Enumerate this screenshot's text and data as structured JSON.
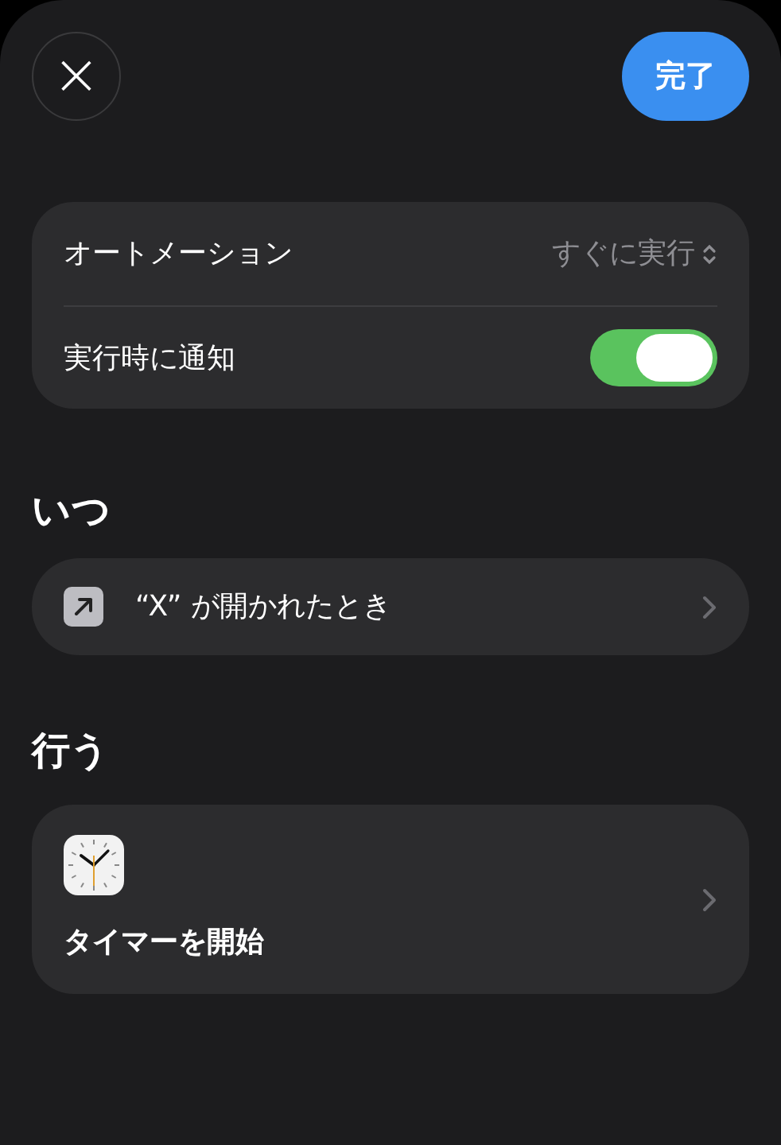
{
  "header": {
    "close_label": "×",
    "done_button": "完了"
  },
  "settings": [
    {
      "kind": "picker",
      "label": "オートメーション",
      "value": "すぐに実行"
    },
    {
      "kind": "toggle",
      "label": "実行時に通知",
      "on": true
    }
  ],
  "when": {
    "heading": "いつ",
    "trigger": "“X” が開かれたとき"
  },
  "do": {
    "heading": "行う",
    "action": "タイマーを開始"
  }
}
